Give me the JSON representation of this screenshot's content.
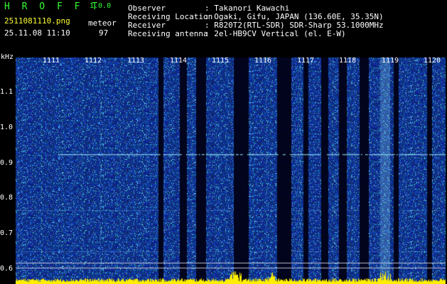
{
  "header": {
    "app_name": "H R O F F T",
    "version": "1.0.0",
    "filename": "2511081110.png",
    "datetime": "25.11.08 11:10",
    "type_label": "meteor",
    "count": "97",
    "info": [
      {
        "label": "Observer",
        "value": ": Takanori Kawachi"
      },
      {
        "label": "Receiving Location",
        "value": ": Ogaki, Gifu, JAPAN (136.60E, 35.35N)"
      },
      {
        "label": "Receiver",
        "value": ": R820T2(RTL-SDR) SDR-Sharp 53.1000MHz"
      },
      {
        "label": "Receiving antenna",
        "value": ": 2el-HB9CV Vertical (el. E-W)"
      }
    ]
  },
  "axes": {
    "y_unit": "kHz",
    "y_ticks": [
      "1.1",
      "1.0",
      "0.9",
      "0.8",
      "0.7",
      "0.6"
    ],
    "x_ticks": [
      "1111",
      "1112",
      "1113",
      "1114",
      "1115",
      "1116",
      "1117",
      "1118",
      "1119",
      "1120"
    ]
  },
  "colors": {
    "background": "#000000",
    "noise_floor": "#0a1c9a",
    "signal": "#9ff0ff",
    "app_name": "#33ff33",
    "filename": "#ffff33",
    "bottom_trace": "#ffee00"
  }
}
